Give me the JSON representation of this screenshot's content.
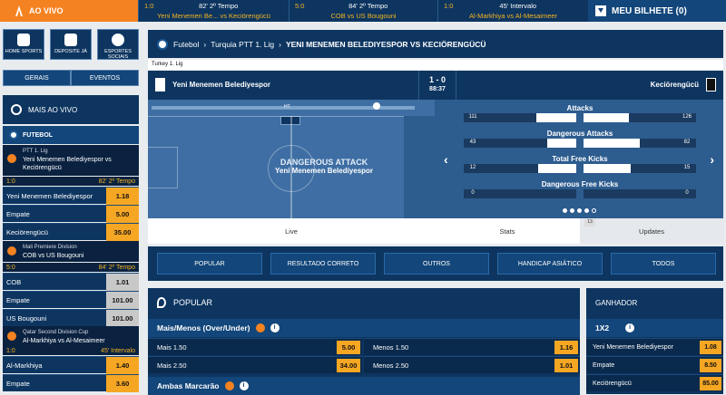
{
  "topbar": {
    "live_label": "AO VIVO",
    "bilhete_label": "MEU BILHETE (0)",
    "matches": [
      {
        "score": "1:0",
        "time": "82' 2º Tempo",
        "teams": "Yeni Menemen Be... vs Keciörengücü"
      },
      {
        "score": "5:0",
        "time": "84' 2º Tempo",
        "teams": "COB vs US Bougouni"
      },
      {
        "score": "1:0",
        "time": "45' Intervalo",
        "teams": "Al-Markhiya vs Al-Mesaimeer"
      }
    ]
  },
  "sidebar": {
    "shortcuts": [
      {
        "label": "HOME SPORTS"
      },
      {
        "label": "DEPOSITE JÁ"
      },
      {
        "label": "ESPORTES SOCIAIS"
      }
    ],
    "tabs": [
      "GERAIS",
      "EVENTOS"
    ],
    "mais_ao_vivo": "MAIS AO VIVO",
    "sport": "FUTEBOL",
    "events": [
      {
        "league": "PTT 1. Lig",
        "name": "Yeni Menemen Belediyespor vs Keciörengücü",
        "score": "1:0",
        "time": "82' 2º Tempo",
        "odds": [
          {
            "label": "Yeni Menemen Belediyespor",
            "value": "1.18"
          },
          {
            "label": "Empate",
            "value": "5.00"
          },
          {
            "label": "Keciörengücü",
            "value": "35.00"
          }
        ]
      },
      {
        "league": "Mali Premiere Division",
        "name": "COB vs US Bougouni",
        "score": "5:0",
        "time": "84' 2º Tempo",
        "odds": [
          {
            "label": "COB",
            "value": "1.01"
          },
          {
            "label": "Empate",
            "value": "101.00"
          },
          {
            "label": "US Bougouni",
            "value": "101.00"
          }
        ]
      },
      {
        "league": "Qatar Second Division Cup",
        "name": "Al-Markhiya vs Al-Mesaimeer",
        "score": "1:0",
        "time": "45' Intervalo",
        "odds": [
          {
            "label": "Al-Markhiya",
            "value": "1.40"
          },
          {
            "label": "Empate",
            "value": "3.60"
          }
        ]
      }
    ]
  },
  "main": {
    "breadcrumb": [
      "Futebol",
      "Turquia PTT 1. Lig",
      "YENI MENEMEN BELEDIYESPOR VS KECIÖRENGÜCÜ"
    ],
    "league_label": "Turkey 1. Lig",
    "home_team": "Yeni Menemen Belediyespor",
    "away_team": "Keciörengücü",
    "score": "1 - 0",
    "clock": "88:37",
    "event_title": "DANGEROUS ATTACK",
    "event_team": "Yeni Menemen Belediyespor",
    "ht_label": "HT",
    "stats": [
      {
        "title": "Attacks",
        "home": 111,
        "away": 126
      },
      {
        "title": "Dangerous Attacks",
        "home": 43,
        "away": 82
      },
      {
        "title": "Total Free Kicks",
        "home": 12,
        "away": 15
      },
      {
        "title": "Dangerous Free Kicks",
        "home": 0,
        "away": 0
      }
    ],
    "view_tabs": [
      "Live",
      "Stats",
      "Updates"
    ],
    "updates_badge": "13",
    "market_tabs": [
      "POPULAR",
      "RESULTADO CORRETO",
      "OUTROS",
      "HANDICAP ASIÁTICO",
      "TODOS"
    ]
  },
  "popular": {
    "title": "POPULAR",
    "overunder_title": "Mais/Menos (Over/Under)",
    "rows": [
      {
        "l_label": "Mais 1.50",
        "l_value": "5.00",
        "r_label": "Menos 1.50",
        "r_value": "1.16"
      },
      {
        "l_label": "Mais 2.50",
        "l_value": "34.00",
        "r_label": "Menos 2.50",
        "r_value": "1.01"
      }
    ],
    "ambas_title": "Ambas Marcarão"
  },
  "ganhador": {
    "title": "GANHADOR",
    "sub": "1X2",
    "rows": [
      {
        "label": "Yeni Menemen Belediyespor",
        "value": "1.08"
      },
      {
        "label": "Empate",
        "value": "8.50"
      },
      {
        "label": "Keciörengücü",
        "value": "85.00"
      }
    ]
  },
  "colors": {
    "accent": "#f58220",
    "odds": "#f5a623",
    "navy": "#0d3560"
  }
}
